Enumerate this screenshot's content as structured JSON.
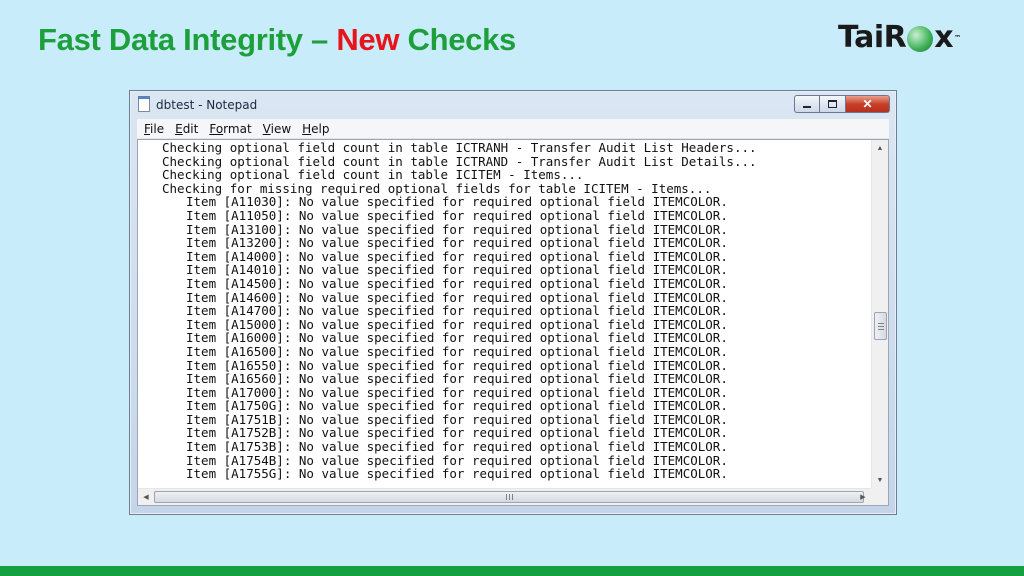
{
  "slide": {
    "title_part1": "Fast Data Integrity – ",
    "title_accent": "New",
    "title_part2": " Checks",
    "logo_left": "TaiR",
    "logo_right": "x",
    "logo_tm": "™"
  },
  "window": {
    "title": "dbtest - Notepad",
    "close_glyph": "✕"
  },
  "menu": [
    {
      "first": "F",
      "rest": "ile"
    },
    {
      "first": "E",
      "rest": "dit"
    },
    {
      "first": "Fo",
      "rest": "rmat"
    },
    {
      "first": "V",
      "rest": "iew"
    },
    {
      "first": "H",
      "rest": "elp"
    }
  ],
  "lines": [
    "Checking optional field count in table ICTRANH - Transfer Audit List Headers...",
    "Checking optional field count in table ICTRAND - Transfer Audit List Details...",
    "Checking optional field count in table ICITEM - Items...",
    "Checking for missing required optional fields for table ICITEM - Items...",
    "Item [A11030]: No value specified for required optional field ITEMCOLOR.",
    "Item [A11050]: No value specified for required optional field ITEMCOLOR.",
    "Item [A13100]: No value specified for required optional field ITEMCOLOR.",
    "Item [A13200]: No value specified for required optional field ITEMCOLOR.",
    "Item [A14000]: No value specified for required optional field ITEMCOLOR.",
    "Item [A14010]: No value specified for required optional field ITEMCOLOR.",
    "Item [A14500]: No value specified for required optional field ITEMCOLOR.",
    "Item [A14600]: No value specified for required optional field ITEMCOLOR.",
    "Item [A14700]: No value specified for required optional field ITEMCOLOR.",
    "Item [A15000]: No value specified for required optional field ITEMCOLOR.",
    "Item [A16000]: No value specified for required optional field ITEMCOLOR.",
    "Item [A16500]: No value specified for required optional field ITEMCOLOR.",
    "Item [A16550]: No value specified for required optional field ITEMCOLOR.",
    "Item [A16560]: No value specified for required optional field ITEMCOLOR.",
    "Item [A17000]: No value specified for required optional field ITEMCOLOR.",
    "Item [A1750G]: No value specified for required optional field ITEMCOLOR.",
    "Item [A1751B]: No value specified for required optional field ITEMCOLOR.",
    "Item [A1752B]: No value specified for required optional field ITEMCOLOR.",
    "Item [A1753B]: No value specified for required optional field ITEMCOLOR.",
    "Item [A1754B]: No value specified for required optional field ITEMCOLOR.",
    "Item [A1755G]: No value specified for required optional field ITEMCOLOR."
  ],
  "colors": {
    "title_green": "#1d9f3c",
    "title_red": "#e8141b",
    "background": "#c9ecfb",
    "bottom_bar": "#13a040"
  }
}
